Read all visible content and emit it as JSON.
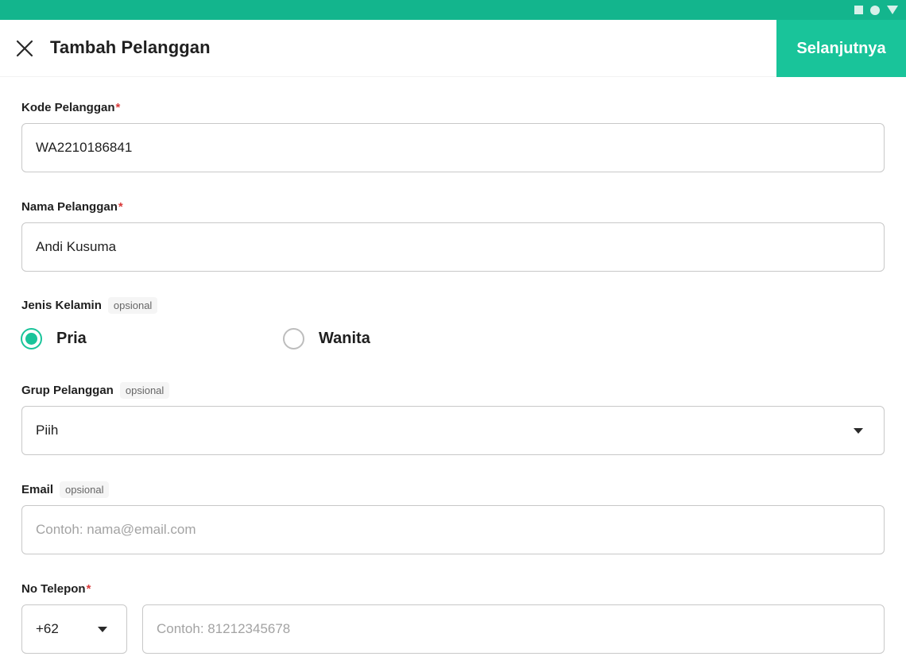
{
  "header": {
    "title": "Tambah Pelanggan",
    "next_label": "Selanjutnya"
  },
  "form": {
    "customer_code": {
      "label": "Kode Pelanggan",
      "required_mark": "*",
      "value": "WA2210186841"
    },
    "customer_name": {
      "label": "Nama Pelanggan",
      "required_mark": "*",
      "value": "Andi Kusuma"
    },
    "gender": {
      "label": "Jenis Kelamin",
      "optional_badge": "opsional",
      "options": [
        {
          "label": "Pria",
          "selected": true
        },
        {
          "label": "Wanita",
          "selected": false
        }
      ]
    },
    "customer_group": {
      "label": "Grup Pelanggan",
      "optional_badge": "opsional",
      "selected_value": "Piih"
    },
    "email": {
      "label": "Email",
      "optional_badge": "opsional",
      "value": "",
      "placeholder": "Contoh: nama@email.com"
    },
    "phone": {
      "label": "No Telepon",
      "required_mark": "*",
      "country_code": "+62",
      "value": "",
      "placeholder": "Contoh: 81212345678"
    }
  },
  "colors": {
    "status_bar": "#13b58d",
    "accent": "#19c49a",
    "required": "#d93a3a"
  },
  "icons": {
    "close": "close-icon",
    "dropdown": "caret-down-icon",
    "status": [
      "square-icon",
      "circle-icon",
      "triangle-icon"
    ]
  }
}
